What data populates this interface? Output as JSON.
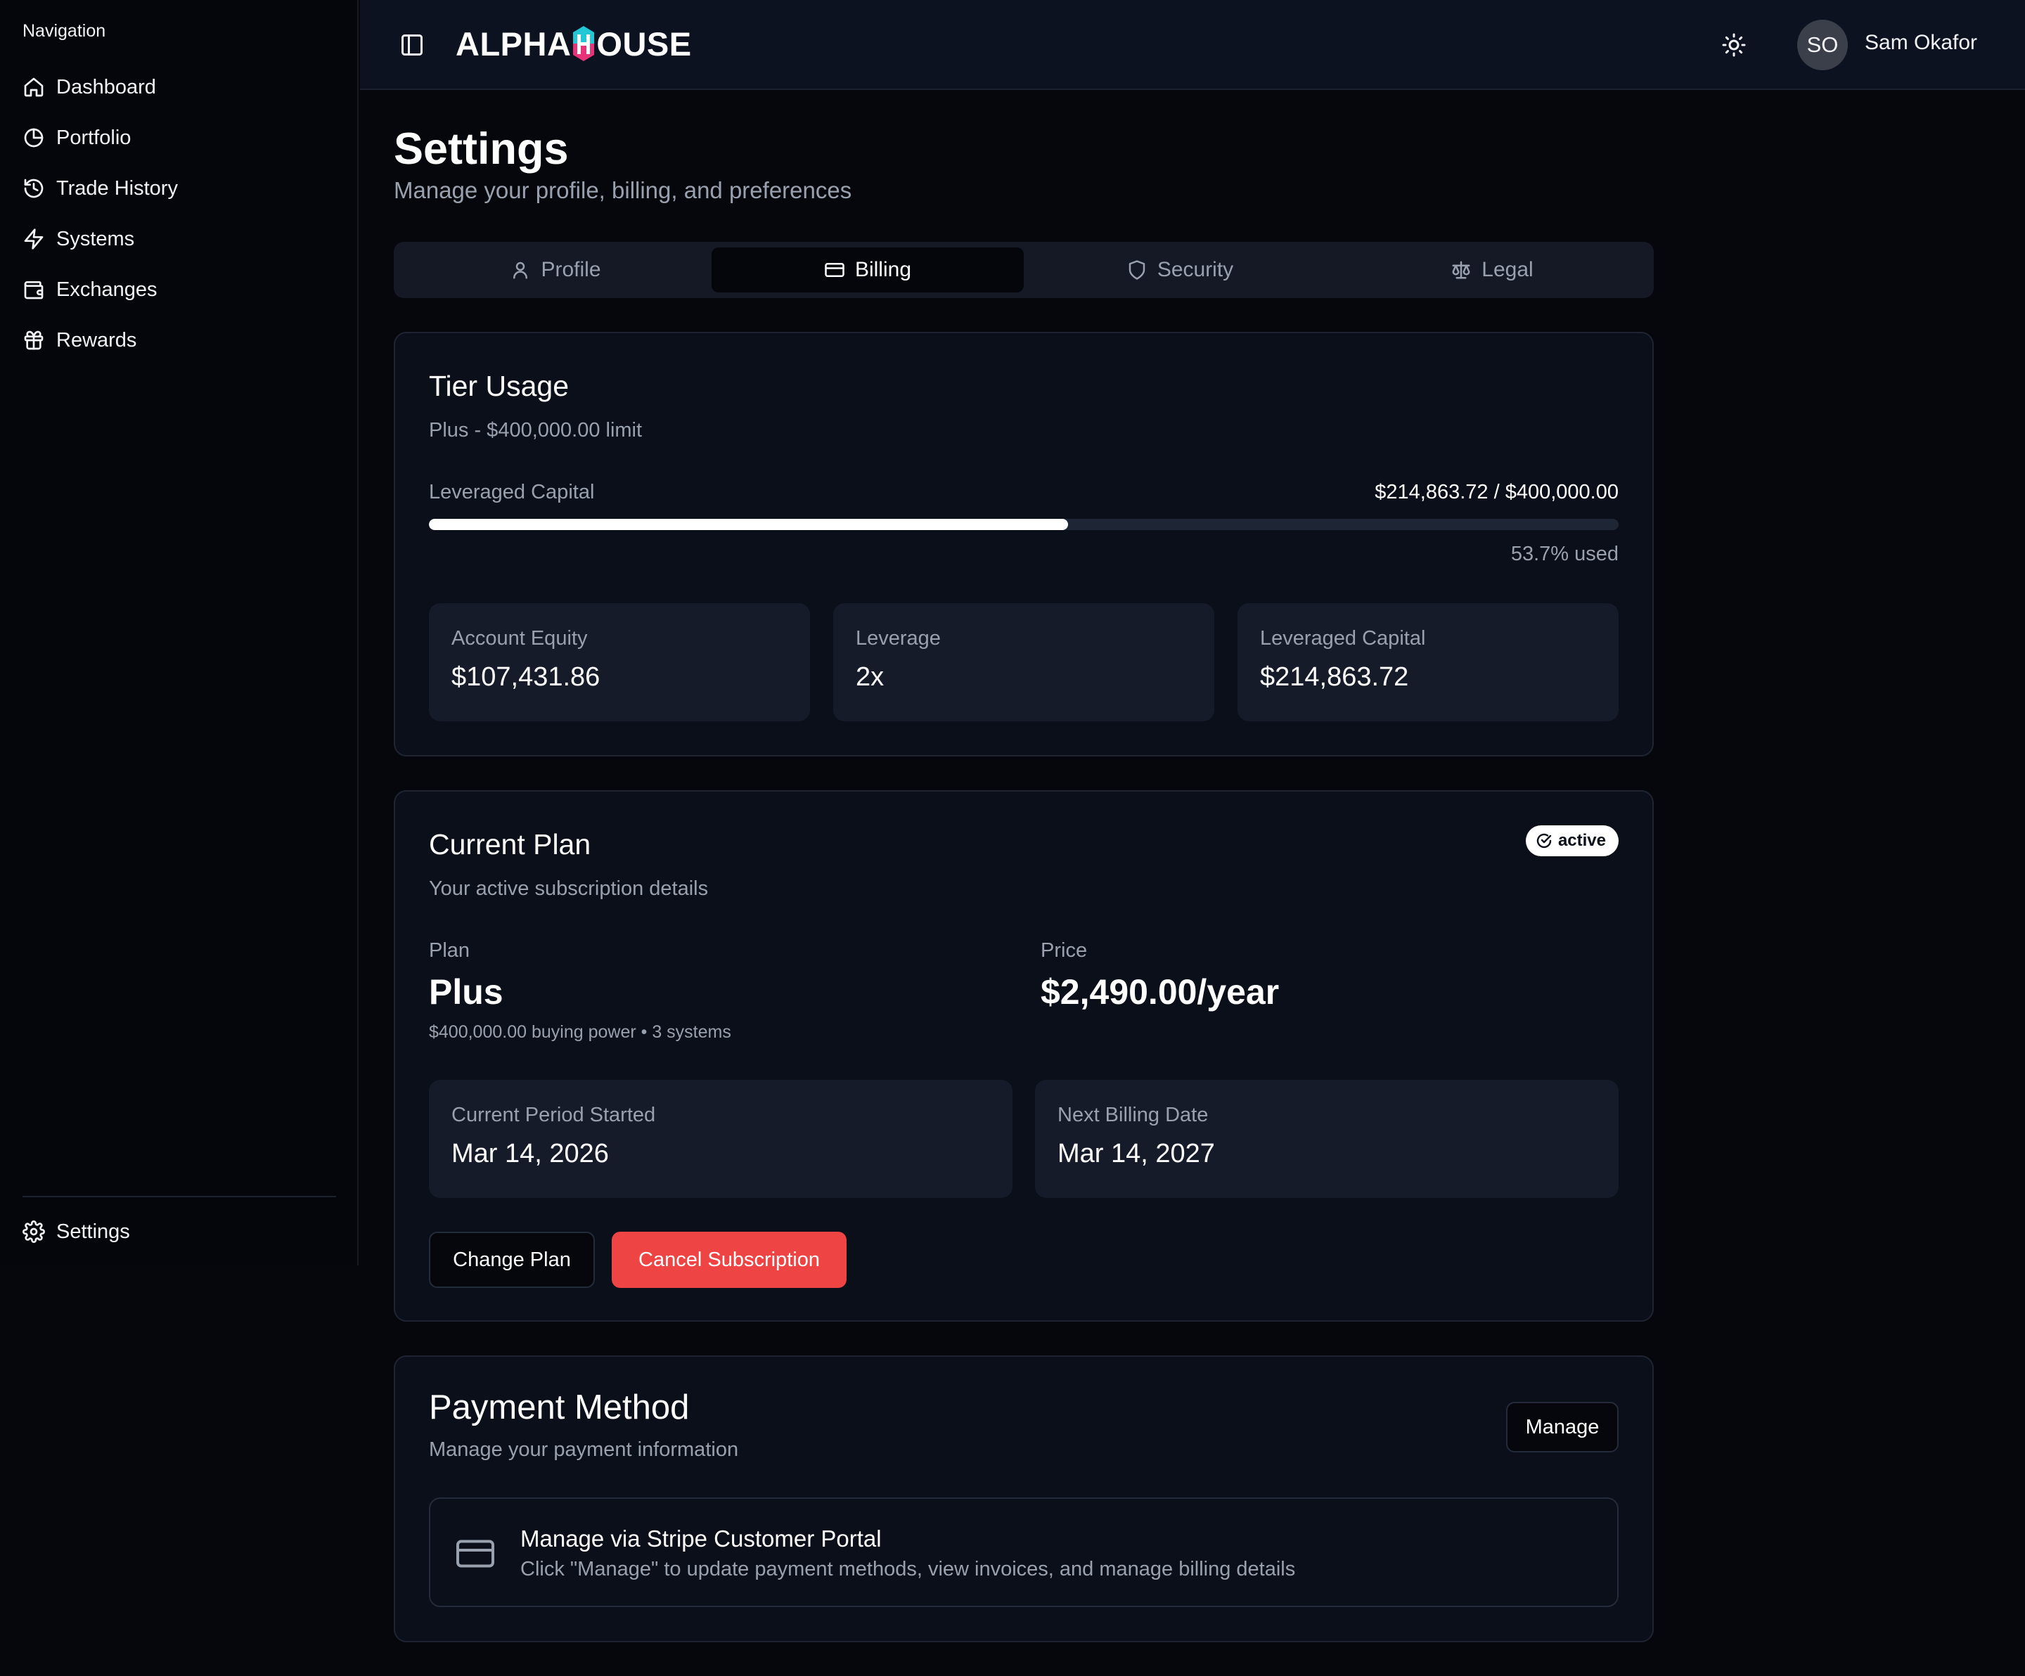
{
  "sidebar": {
    "heading": "Navigation",
    "items": [
      {
        "label": "Dashboard",
        "icon": "home-icon"
      },
      {
        "label": "Portfolio",
        "icon": "pie-chart-icon"
      },
      {
        "label": "Trade History",
        "icon": "history-icon"
      },
      {
        "label": "Systems",
        "icon": "lightning-icon"
      },
      {
        "label": "Exchanges",
        "icon": "wallet-icon"
      },
      {
        "label": "Rewards",
        "icon": "gift-icon"
      }
    ],
    "settings": {
      "label": "Settings",
      "icon": "gear-icon"
    }
  },
  "topbar": {
    "logo_left": "ALPHA",
    "logo_right": "OUSE",
    "avatar_initials": "SO",
    "user_name": "Sam Okafor"
  },
  "page": {
    "title": "Settings",
    "subtitle": "Manage your profile, billing, and preferences"
  },
  "tabs": [
    {
      "label": "Profile",
      "icon": "user-icon",
      "active": false
    },
    {
      "label": "Billing",
      "icon": "credit-card-icon",
      "active": true
    },
    {
      "label": "Security",
      "icon": "shield-icon",
      "active": false
    },
    {
      "label": "Legal",
      "icon": "scale-icon",
      "active": false
    }
  ],
  "tier_usage": {
    "title": "Tier Usage",
    "description": "Plus - $400,000.00 limit",
    "usage_label": "Leveraged Capital",
    "usage_amount": "$214,863.72 / $400,000.00",
    "usage_fraction": 0.537,
    "usage_pct_text": "53.7% used",
    "stats": [
      {
        "label": "Account Equity",
        "value": "$107,431.86"
      },
      {
        "label": "Leverage",
        "value": "2x"
      },
      {
        "label": "Leveraged Capital",
        "value": "$214,863.72"
      }
    ]
  },
  "current_plan": {
    "title": "Current Plan",
    "description": "Your active subscription details",
    "badge": "active",
    "plan_label": "Plan",
    "plan_value": "Plus",
    "plan_note": "$400,000.00 buying power • 3 systems",
    "price_label": "Price",
    "price_value": "$2,490.00/year",
    "period_started_label": "Current Period Started",
    "period_started_value": "Mar 14, 2026",
    "next_billing_label": "Next Billing Date",
    "next_billing_value": "Mar 14, 2027",
    "change_plan_label": "Change Plan",
    "cancel_label": "Cancel Subscription"
  },
  "payment_method": {
    "title": "Payment Method",
    "description": "Manage your payment information",
    "manage_label": "Manage",
    "portal_title": "Manage via Stripe Customer Portal",
    "portal_description": "Click \"Manage\" to update payment methods, view invoices, and manage billing details"
  },
  "colors": {
    "background": "#05070d",
    "card": "#0b0f19",
    "danger": "#ef4444",
    "logo_hex_top": "#22c7d6",
    "logo_hex_bottom": "#e6337a"
  }
}
